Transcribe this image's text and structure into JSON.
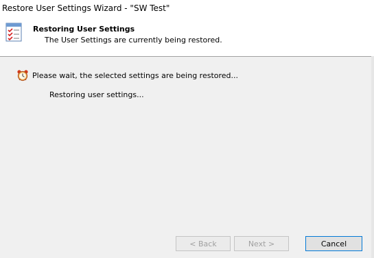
{
  "window": {
    "title": "Restore User Settings Wizard - \"SW Test\""
  },
  "header": {
    "title": "Restoring User Settings",
    "subtitle": "The User Settings are currently being restored.",
    "icon": "checklist-icon"
  },
  "body": {
    "wait_icon": "alarm-clock-icon",
    "wait_message": "Please wait, the selected settings are being restored...",
    "status": "Restoring user settings..."
  },
  "buttons": {
    "back": "< Back",
    "next": "Next >",
    "cancel": "Cancel"
  },
  "colors": {
    "header_bg": "#ffffff",
    "body_bg": "#f0f0f0",
    "disabled_text": "#a0a0a0"
  }
}
